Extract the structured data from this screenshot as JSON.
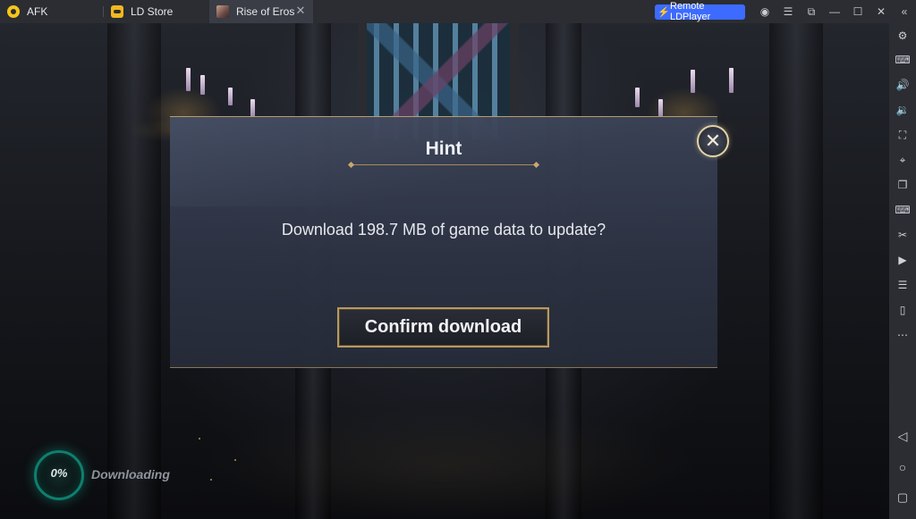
{
  "titlebar": {
    "tabs": [
      {
        "label": "AFK",
        "icon": "afk-app-icon"
      },
      {
        "label": "LD Store",
        "icon": "ld-store-icon"
      },
      {
        "label": "Rise of Eros",
        "icon": "rise-of-eros-icon",
        "active": true
      }
    ],
    "tab_close_symbol": "✕",
    "remote_button": {
      "label": "Remote LDPlayer",
      "icon": "lightning-icon",
      "color": "#3d6bff"
    },
    "controls": [
      {
        "name": "account-icon",
        "symbol": "◉"
      },
      {
        "name": "menu-icon",
        "symbol": "☰"
      },
      {
        "name": "restore-window-icon",
        "symbol": "⧉"
      },
      {
        "name": "minimize-icon",
        "symbol": "—"
      },
      {
        "name": "maximize-icon",
        "symbol": "☐"
      },
      {
        "name": "close-window-icon",
        "symbol": "✕"
      },
      {
        "name": "collapse-sidebar-icon",
        "symbol": "«"
      }
    ]
  },
  "dialog": {
    "title": "Hint",
    "message": "Download 198.7 MB of game data to update?",
    "confirm_label": "Confirm download",
    "close_symbol": "✕"
  },
  "progress": {
    "percent_label": "0%",
    "percent_value": 0,
    "status": "Downloading",
    "color": "#0f7f6f"
  },
  "sidebar": {
    "items": [
      {
        "name": "settings-icon",
        "symbol": "⚙"
      },
      {
        "name": "keyboard-mapping-icon",
        "symbol": "⌨"
      },
      {
        "name": "volume-up-icon",
        "symbol": "🔊"
      },
      {
        "name": "volume-down-icon",
        "symbol": "🔉"
      },
      {
        "name": "fullscreen-icon",
        "symbol": "⛶"
      },
      {
        "name": "location-icon",
        "symbol": "⌖"
      },
      {
        "name": "multi-instance-icon",
        "symbol": "❐"
      },
      {
        "name": "keymap-icon",
        "symbol": "⌨"
      },
      {
        "name": "scissors-icon",
        "symbol": "✂"
      },
      {
        "name": "record-video-icon",
        "symbol": "▶"
      },
      {
        "name": "operation-record-icon",
        "symbol": "☰"
      },
      {
        "name": "sync-icon",
        "symbol": "▯"
      },
      {
        "name": "more-icon",
        "symbol": "⋯"
      }
    ],
    "nav": [
      {
        "name": "back-icon",
        "symbol": "◁"
      },
      {
        "name": "home-icon",
        "symbol": "○"
      },
      {
        "name": "recent-apps-icon",
        "symbol": "▢"
      }
    ]
  }
}
